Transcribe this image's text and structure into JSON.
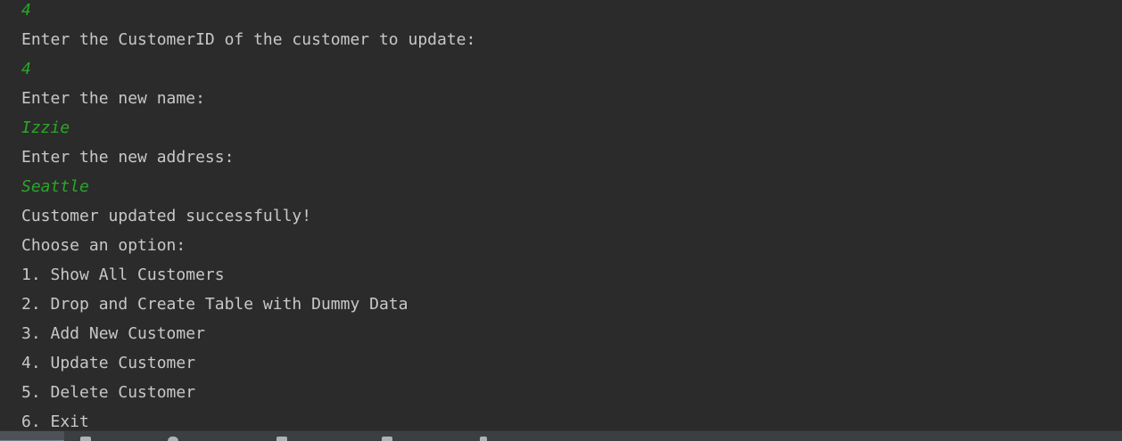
{
  "console": {
    "lines": [
      {
        "text": "4",
        "kind": "user-input"
      },
      {
        "text": "Enter the CustomerID of the customer to update:",
        "kind": "output"
      },
      {
        "text": "4",
        "kind": "user-input"
      },
      {
        "text": "Enter the new name:",
        "kind": "output"
      },
      {
        "text": "Izzie",
        "kind": "user-input"
      },
      {
        "text": "Enter the new address:",
        "kind": "output"
      },
      {
        "text": "Seattle",
        "kind": "user-input"
      },
      {
        "text": "Customer updated successfully!",
        "kind": "output"
      },
      {
        "text": "Choose an option:",
        "kind": "output"
      },
      {
        "text": "1. Show All Customers",
        "kind": "output"
      },
      {
        "text": "2. Drop and Create Table with Dummy Data",
        "kind": "output"
      },
      {
        "text": "3. Add New Customer",
        "kind": "output"
      },
      {
        "text": "4. Update Customer",
        "kind": "output"
      },
      {
        "text": "5. Delete Customer",
        "kind": "output"
      },
      {
        "text": "6. Exit",
        "kind": "output"
      }
    ]
  },
  "colors": {
    "background": "#2b2b2b",
    "output_text": "#c8c8c8",
    "user_input_text": "#29a829",
    "toolbar": "#3c3f41"
  },
  "toolbar": {
    "icons": [
      "terminal-tab-icon",
      "list-icon",
      "search-icon",
      "stop-icon",
      "print-icon",
      "edit-icon"
    ]
  }
}
